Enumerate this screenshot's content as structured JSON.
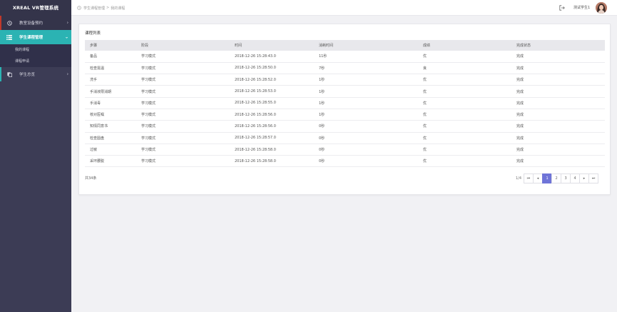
{
  "app": {
    "brand": "XREAL VR管理系统"
  },
  "sidebar": {
    "items": [
      {
        "label": "教室设备预约",
        "icon": "clock-icon"
      },
      {
        "label": "学生课程管理",
        "icon": "list-icon"
      },
      {
        "label": "学生总览",
        "icon": "copy-icon"
      }
    ],
    "sub_items": [
      {
        "label": "我的课程"
      },
      {
        "label": "课程申请"
      }
    ]
  },
  "header": {
    "breadcrumb": [
      "学生课程管理",
      "我的课程"
    ],
    "breadcrumb_separator": ">",
    "username": "测试学生1"
  },
  "panel": {
    "title": "课程列表",
    "columns": [
      "步骤",
      "阶段",
      "时间",
      "消耗时间",
      "成绩",
      "完成状态"
    ],
    "rows": [
      [
        "备品",
        "学习模式",
        "2018-12-26 15:28:43.0",
        "11秒",
        "优",
        "完成"
      ],
      [
        "检查需温",
        "学习模式",
        "2018-12-26 15:28:50.0",
        "7秒",
        "良",
        "完成"
      ],
      [
        "洗手",
        "学习模式",
        "2018-12-26 15:28:52.0",
        "1秒",
        "优",
        "完成"
      ],
      [
        "手消液限消期",
        "学习模式",
        "2018-12-26 15:28:53.0",
        "1秒",
        "优",
        "完成"
      ],
      [
        "手消毒",
        "学习模式",
        "2018-12-26 15:28:55.0",
        "1秒",
        "优",
        "完成"
      ],
      [
        "核对医嘱",
        "学习模式",
        "2018-12-26 15:28:56.0",
        "1秒",
        "优",
        "完成"
      ],
      [
        "知情同意书",
        "学习模式",
        "2018-12-26 15:28:56.0",
        "0秒",
        "优",
        "完成"
      ],
      [
        "检查圆盘",
        "学习模式",
        "2018-12-26 15:28:57.0",
        "0秒",
        "优",
        "完成"
      ],
      [
        "过敏",
        "学习模式",
        "2018-12-26 15:28:58.0",
        "0秒",
        "优",
        "完成"
      ],
      [
        "采环腰脱",
        "学习模式",
        "2018-12-26 15:28:58.0",
        "0秒",
        "优",
        "完成"
      ]
    ],
    "total": "共34条",
    "pager": {
      "info": "1/4",
      "first": "⏮",
      "prev": "◂",
      "pages": [
        "1",
        "2",
        "3",
        "4"
      ],
      "current": "1",
      "next": "▸",
      "last": "⏭"
    }
  },
  "colors": {
    "sidebar": "#3c3c55",
    "active": "#2bb3b3",
    "pager_active": "#6f74d8",
    "first_item_accent": "#c0392b"
  }
}
